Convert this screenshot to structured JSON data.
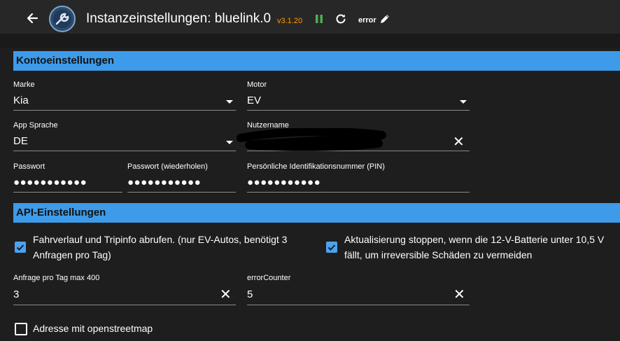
{
  "header": {
    "title": "Instanzeinstellungen: bluelink.0",
    "version": "v3.1.20",
    "status": "error",
    "icons": [
      "back-arrow-icon",
      "adapter-logo-icon",
      "pause-icon",
      "reload-icon",
      "edit-pencil-icon"
    ],
    "colors": {
      "version": "#ff9800",
      "pause": "#4caf50",
      "accent": "#3d9be9"
    }
  },
  "sections": {
    "account": "Kontoeinstellungen",
    "api": "API-Einstellungen"
  },
  "fields": {
    "brand": {
      "label": "Marke",
      "value": "Kia"
    },
    "motor": {
      "label": "Motor",
      "value": "EV"
    },
    "language": {
      "label": "App Sprache",
      "value": "DE"
    },
    "username": {
      "label": "Nutzername",
      "value": ""
    },
    "password": {
      "label": "Passwort",
      "value": "●●●●●●●●●●●"
    },
    "password_repeat": {
      "label": "Passwort (wiederholen)",
      "value": "●●●●●●●●●●●"
    },
    "pin": {
      "label": "Persönliche Identifikationsnummer (PIN)",
      "value": "●●●●●●●●●●●"
    },
    "requests": {
      "label": "Anfrage pro Tag max 400",
      "value": "3"
    },
    "error_counter": {
      "label": "errorCounter",
      "value": "5"
    }
  },
  "checkboxes": {
    "tripinfo": {
      "line1": "Fahrverlauf und Tripinfo abrufen. (nur EV-Autos, benötigt 3",
      "line2": "Anfragen pro Tag)",
      "checked": true
    },
    "battery_stop": {
      "line1": "Aktualisierung stoppen, wenn die 12-V-Batterie unter 10,5 V",
      "line2": "fällt, um irreversible Schäden zu vermeiden",
      "checked": true
    },
    "openstreetmap": {
      "label": "Adresse mit openstreetmap",
      "checked": false
    }
  },
  "clear_symbol": "✕"
}
